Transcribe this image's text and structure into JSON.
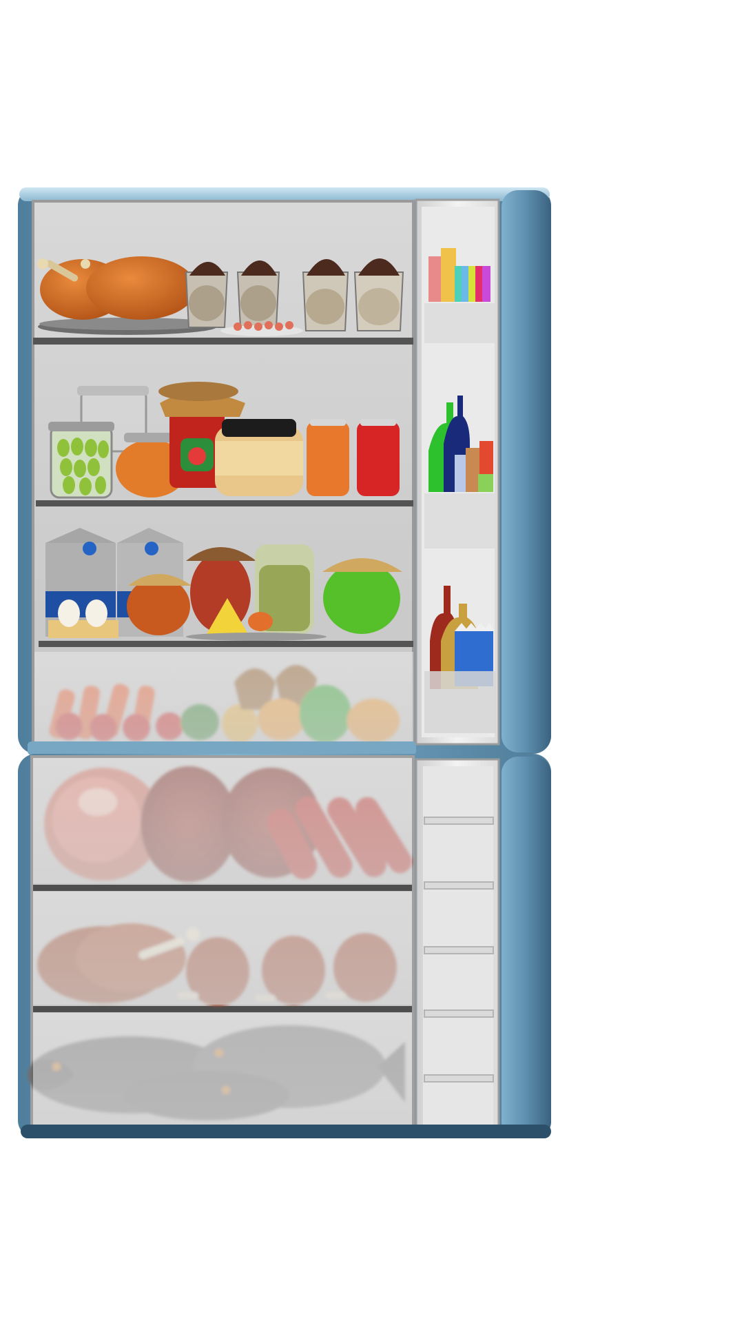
{
  "scene": {
    "subject": "refrigerator-open-doors",
    "colors": {
      "background": "#ffffff",
      "fridge_body": "#5e8fae",
      "fridge_body_dark": "#3c6784",
      "fridge_highlight": "#a9cfe3",
      "interior": "#cdcdcd",
      "shelf": "#545454",
      "door_shelf": "#e8e8e8"
    },
    "compartments": {
      "fridge": {
        "shelves": [
          {
            "items": [
              "roast-chicken",
              "chocolate-pudding-cups",
              "shrimp-plate"
            ]
          },
          {
            "items": [
              "olive-jar",
              "jam-jar",
              "strawberry-jam",
              "honey-jar",
              "orange-can",
              "red-can"
            ]
          },
          {
            "items": [
              "milk-cartons",
              "eggs",
              "orange-jam-jar",
              "red-jam-jar",
              "cheese",
              "juice-pitcher",
              "green-jam-jar"
            ]
          }
        ],
        "crisper": {
          "items": [
            "carrots",
            "tomatoes",
            "peppers",
            "lemons",
            "oranges",
            "bananas",
            "avocado"
          ]
        },
        "door_shelves": [
          {
            "items": [
              "juice-cartons",
              "colored-bottles"
            ]
          },
          {
            "items": [
              "green-bottle",
              "blue-bottle",
              "small-bottles"
            ]
          },
          {
            "items": [
              "sauce-bottles",
              "milk-cartons-small"
            ]
          }
        ]
      },
      "freezer": {
        "drawers": [
          {
            "items": [
              "steak",
              "salami",
              "sausages"
            ]
          },
          {
            "items": [
              "chicken",
              "drumsticks"
            ]
          },
          {
            "items": [
              "fish"
            ]
          }
        ],
        "door_shelves": [
          {
            "items": []
          },
          {
            "items": []
          },
          {
            "items": []
          },
          {
            "items": []
          },
          {
            "items": []
          }
        ]
      }
    }
  }
}
